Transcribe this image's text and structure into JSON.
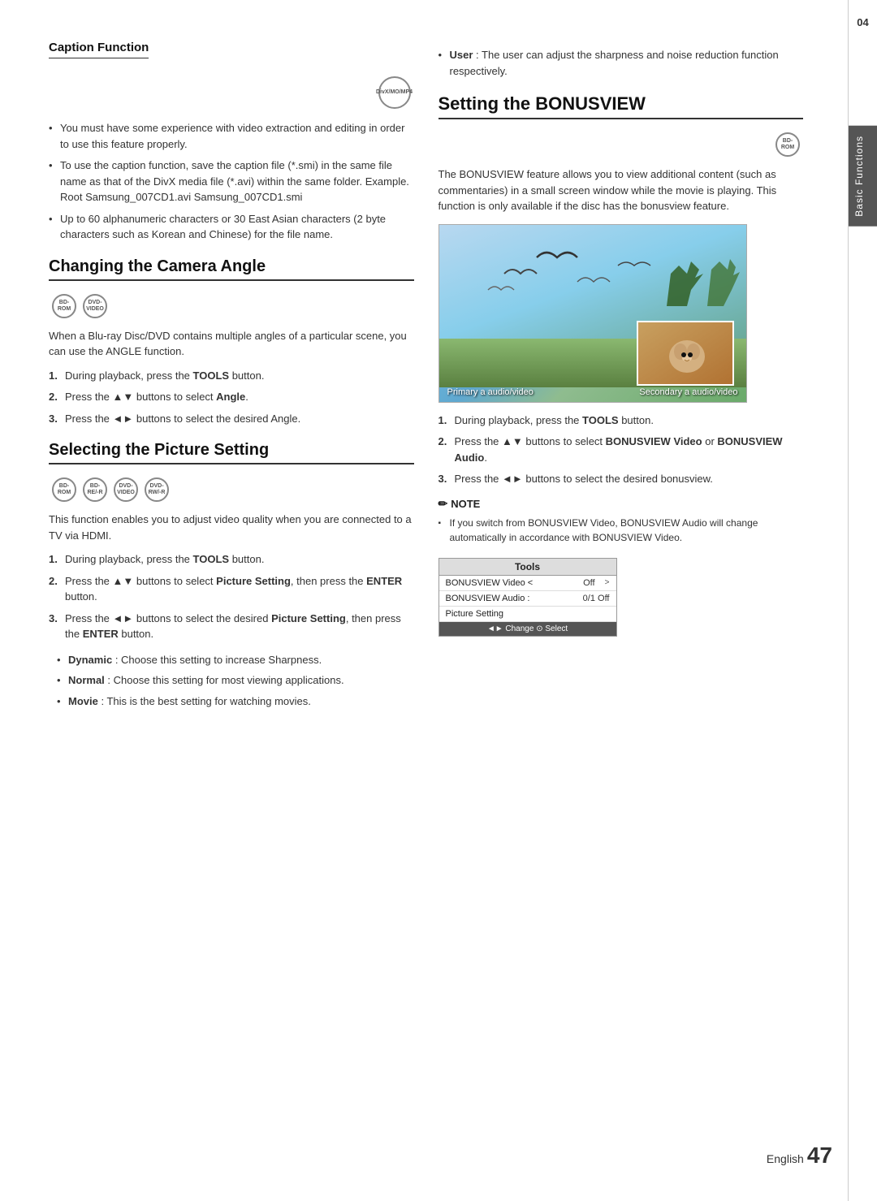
{
  "page": {
    "number": "47",
    "language": "English"
  },
  "sidebar": {
    "chapter": "04",
    "label": "Basic Functions"
  },
  "caption_function": {
    "title": "Caption Function",
    "badge": "DivX/MO/MP4",
    "bullets": [
      "You must have some experience with video extraction and editing in order to use this feature properly.",
      "To use the caption function, save the caption file (*.smi) in the same file name as that of the DivX media file (*.avi) within the same folder. Example. Root Samsung_007CD1.avi Samsung_007CD1.smi",
      "Up to 60 alphanumeric characters or 30 East Asian characters (2 byte characters such as Korean and Chinese) for the file name."
    ]
  },
  "changing_camera_angle": {
    "title": "Changing the Camera Angle",
    "badges": [
      "BD-ROM",
      "DVD-VIDEO"
    ],
    "intro": "When a Blu-ray Disc/DVD contains multiple angles of a particular scene, you can use the ANGLE function.",
    "steps": [
      {
        "num": "1.",
        "text": "During playback, press the ",
        "bold": "TOOLS",
        "rest": " button."
      },
      {
        "num": "2.",
        "text": "Press the ▲▼ buttons to select ",
        "bold": "Angle",
        "rest": "."
      },
      {
        "num": "3.",
        "text": "Press the ◄► buttons to select the desired Angle."
      }
    ]
  },
  "selecting_picture_setting": {
    "title": "Selecting the Picture Setting",
    "badges": [
      "BD-ROM",
      "BD-RE/-R",
      "DVD-VIDEO",
      "DVD-RW/-R"
    ],
    "intro": "This function enables you to adjust video quality when you are connected to a TV via HDMI.",
    "steps": [
      {
        "num": "1.",
        "text": "During playback, press the ",
        "bold": "TOOLS",
        "rest": " button."
      },
      {
        "num": "2.",
        "text": "Press the ▲▼ buttons to select ",
        "bold": "Picture Setting",
        "rest": ", then press the ",
        "bold2": "ENTER",
        "rest2": " button."
      },
      {
        "num": "3.",
        "text": "Press the ◄► buttons to select the desired ",
        "bold": "Picture Setting",
        "rest": ", then press the ",
        "bold2": "ENTER",
        "rest2": " button."
      }
    ],
    "sub_bullets": [
      {
        "bold": "Dynamic",
        "text": " : Choose this setting to increase Sharpness."
      },
      {
        "bold": "Normal",
        "text": " : Choose this setting for most viewing applications."
      },
      {
        "bold": "Movie",
        "text": " : This is the best setting for watching movies."
      }
    ]
  },
  "user_note": {
    "text": "User",
    "rest": " : The user can adjust the sharpness and noise reduction function respectively."
  },
  "setting_bonusview": {
    "title": "Setting the BONUSVIEW",
    "badge": "BD-ROM",
    "intro": "The BONUSVIEW feature allows you to view additional content (such as commentaries) in a small screen window while the movie is playing. This function is only available if the disc has the bonusview feature.",
    "image_primary_label": "Primary a audio/video",
    "image_secondary_label": "Secondary a audio/video",
    "steps": [
      {
        "num": "1.",
        "text": "During playback, press the ",
        "bold": "TOOLS",
        "rest": " button."
      },
      {
        "num": "2.",
        "text": "Press the ▲▼ buttons to select ",
        "bold": "BONUSVIEW Video",
        "rest": " or ",
        "bold2": "BONUSVIEW Audio",
        "rest2": "."
      },
      {
        "num": "3.",
        "text": "Press the ◄► buttons to select the desired bonusview."
      }
    ],
    "note": {
      "title": "NOTE",
      "bullets": [
        "If you switch from BONUSVIEW Video, BONUSVIEW Audio will change automatically in accordance with BONUSVIEW Video."
      ]
    },
    "tools_table": {
      "title": "Tools",
      "rows": [
        {
          "label": "BONUSVIEW Video <",
          "value": "Off",
          "arrow": ">"
        },
        {
          "label": "BONUSVIEW Audio :",
          "value": "0/1 Off"
        },
        {
          "label": "Picture Setting",
          "value": ""
        }
      ],
      "footer": "◄► Change   ⊙ Select"
    }
  }
}
